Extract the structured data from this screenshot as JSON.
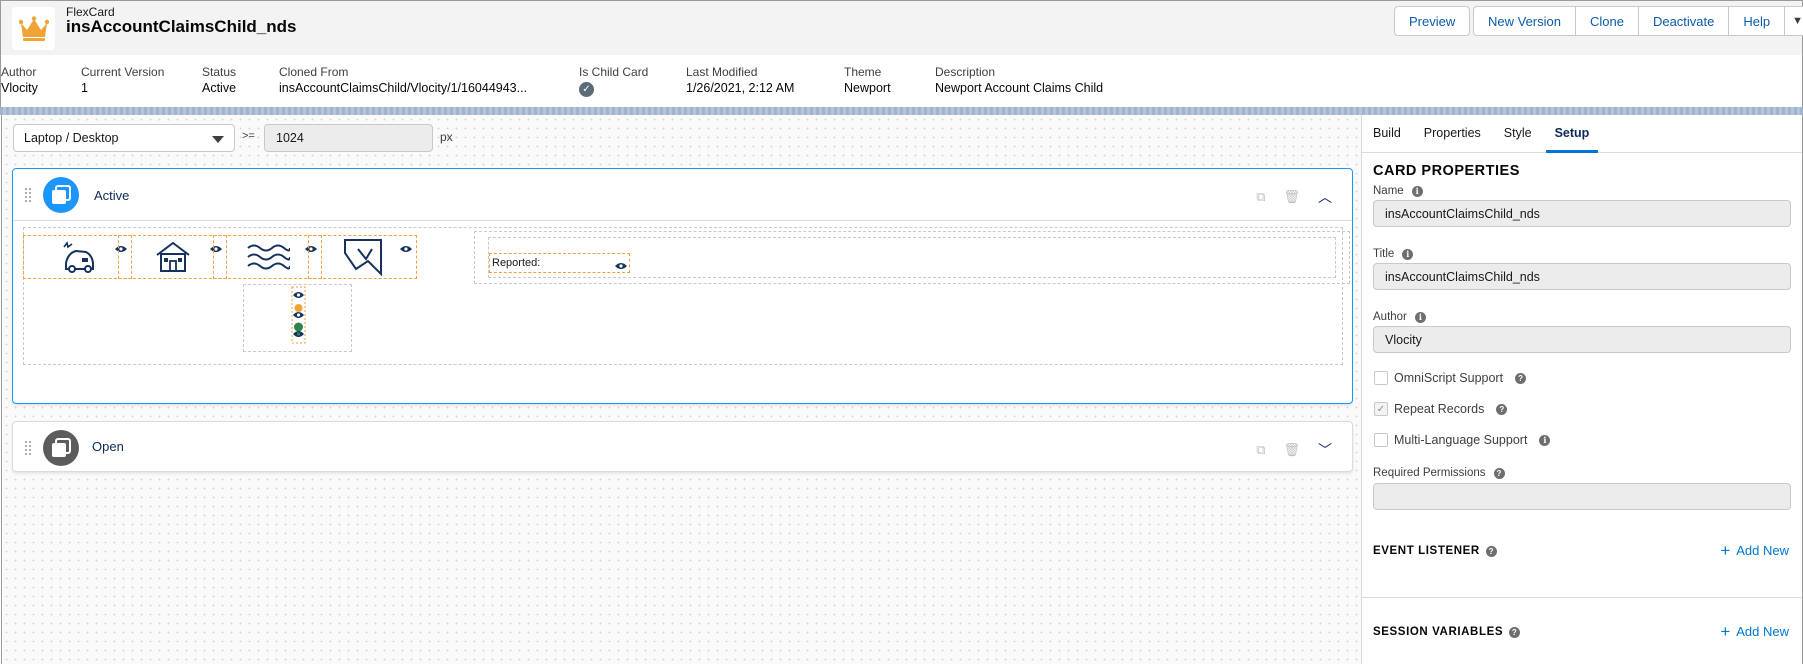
{
  "header": {
    "app_type": "FlexCard",
    "title": "insAccountClaimsChild_nds",
    "actions": [
      "Preview",
      "New Version",
      "Clone",
      "Deactivate",
      "Help"
    ]
  },
  "meta": [
    {
      "label": "Author",
      "value": "Vlocity"
    },
    {
      "label": "Current Version",
      "value": "1"
    },
    {
      "label": "Status",
      "value": "Active"
    },
    {
      "label": "Cloned From",
      "value": "insAccountClaimsChild/Vlocity/1/16044943..."
    },
    {
      "label": "Is Child Card",
      "value": ""
    },
    {
      "label": "Last Modified",
      "value": "1/26/2021, 2:12 AM"
    },
    {
      "label": "Theme",
      "value": "Newport"
    },
    {
      "label": "Description",
      "value": "Newport Account Claims Child"
    }
  ],
  "canvas": {
    "device": "Laptop / Desktop",
    "operator": ">=",
    "width_value": "1024",
    "unit": "px",
    "states": [
      {
        "name": "Active",
        "expanded": true
      },
      {
        "name": "Open",
        "expanded": false
      }
    ],
    "reported_label": "Reported:"
  },
  "panel": {
    "tabs": [
      "Build",
      "Properties",
      "Style",
      "Setup"
    ],
    "active_tab": "Setup",
    "section_title": "CARD PROPERTIES",
    "fields": {
      "name_label": "Name",
      "name_value": "insAccountClaimsChild_nds",
      "title_label": "Title",
      "title_value": "insAccountClaimsChild_nds",
      "author_label": "Author",
      "author_value": "Vlocity"
    },
    "checkboxes": [
      {
        "label": "OmniScript Support",
        "checked": false
      },
      {
        "label": "Repeat Records",
        "checked": true
      },
      {
        "label": "Multi-Language Support",
        "checked": false
      }
    ],
    "required_permissions_label": "Required Permissions",
    "required_permissions_value": "",
    "event_listener_title": "EVENT LISTENER",
    "session_variables_title": "SESSION VARIABLES",
    "add_new_label": "Add New"
  },
  "colors": {
    "accent": "#1b96ff",
    "link": "#0176d3",
    "crown": "#f0a436",
    "status_green": "#2e844a",
    "dashed_orange": "#f0a040"
  }
}
